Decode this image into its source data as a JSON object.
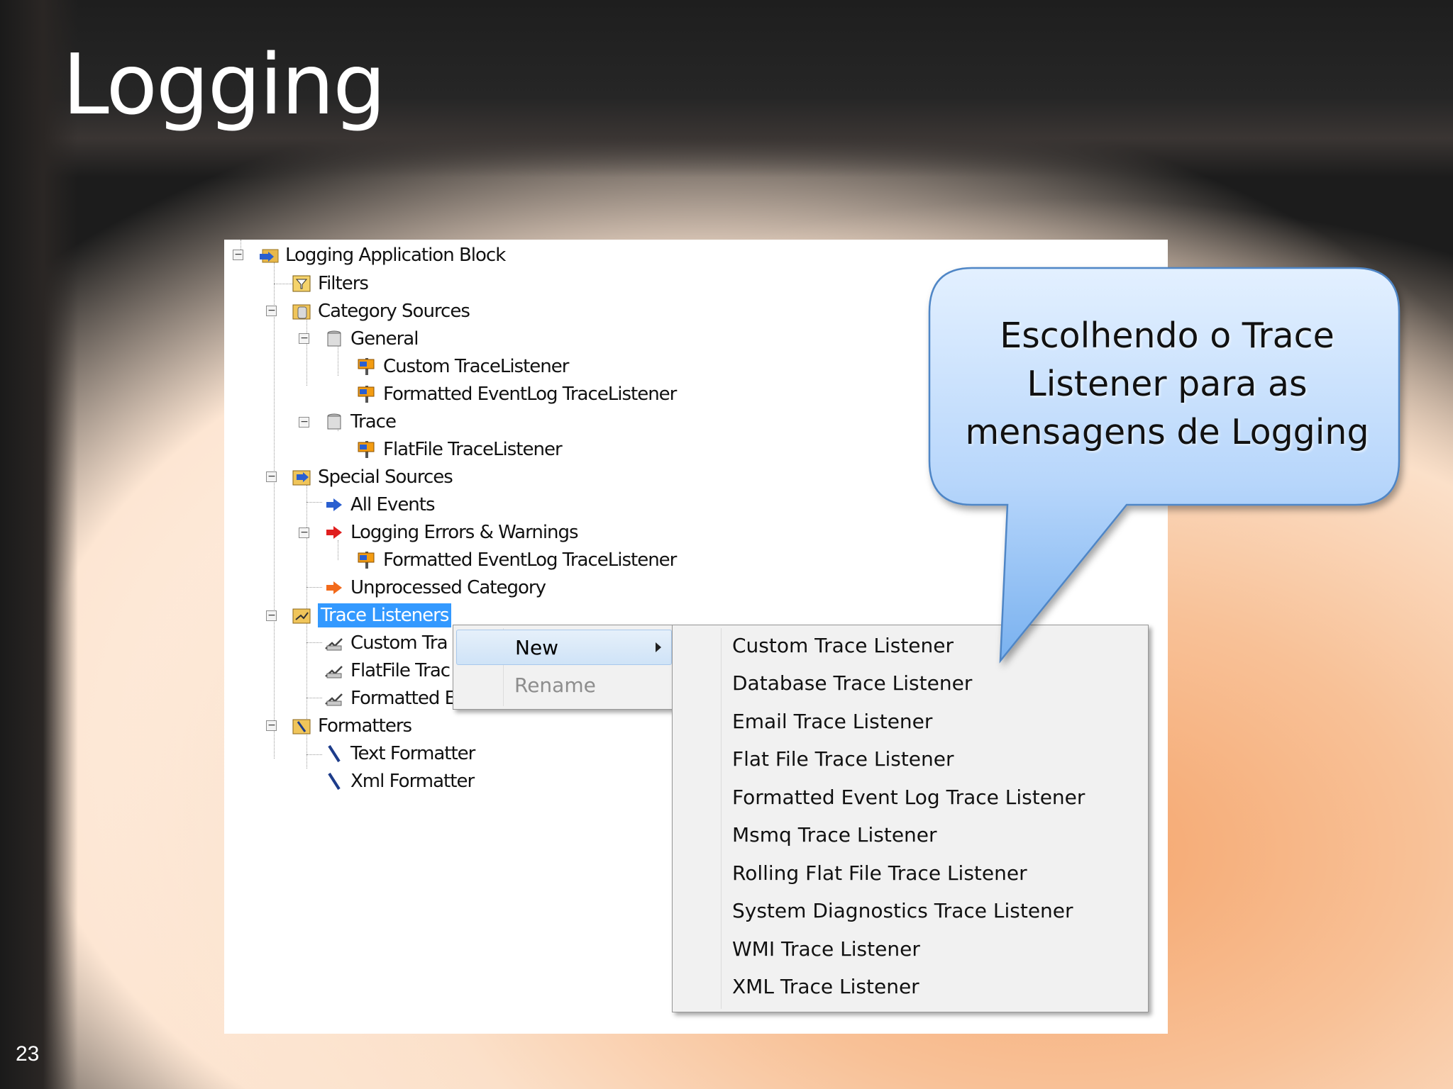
{
  "slide": {
    "title": "Logging",
    "number": "23"
  },
  "tree": {
    "nodes": [
      {
        "label": "Logging Application Block",
        "icon": "folder-block-icon"
      },
      {
        "label": "Filters",
        "icon": "filter-icon"
      },
      {
        "label": "Category Sources",
        "icon": "category-sources-icon"
      },
      {
        "label": "General",
        "icon": "category-icon"
      },
      {
        "label": "Custom TraceListener",
        "icon": "trace-listener-ref-icon"
      },
      {
        "label": "Formatted EventLog TraceListener",
        "icon": "trace-listener-ref-icon"
      },
      {
        "label": "Trace",
        "icon": "category-icon"
      },
      {
        "label": "FlatFile TraceListener",
        "icon": "trace-listener-ref-icon"
      },
      {
        "label": "Special Sources",
        "icon": "special-sources-icon"
      },
      {
        "label": "All Events",
        "icon": "blue-arrow-icon"
      },
      {
        "label": "Logging Errors & Warnings",
        "icon": "red-arrow-icon"
      },
      {
        "label": "Formatted EventLog TraceListener",
        "icon": "trace-listener-ref-icon"
      },
      {
        "label": "Unprocessed Category",
        "icon": "orange-arrow-icon"
      },
      {
        "label": "Trace Listeners",
        "icon": "trace-listeners-folder-icon"
      },
      {
        "label": "Custom Tra",
        "icon": "listener-icon"
      },
      {
        "label": "FlatFile Trac",
        "icon": "listener-icon"
      },
      {
        "label": "Formatted E",
        "icon": "listener-icon"
      },
      {
        "label": "Formatters",
        "icon": "formatters-icon"
      },
      {
        "label": "Text Formatter",
        "icon": "pen-icon"
      },
      {
        "label": "Xml Formatter",
        "icon": "pen-icon"
      }
    ],
    "expander_symbol": "−"
  },
  "context_menu": {
    "items": [
      {
        "label": "New"
      },
      {
        "label": "Rename"
      }
    ]
  },
  "submenu": {
    "items": [
      {
        "label": "Custom Trace Listener"
      },
      {
        "label": "Database Trace Listener"
      },
      {
        "label": "Email Trace Listener"
      },
      {
        "label": "Flat File Trace Listener"
      },
      {
        "label": "Formatted Event Log Trace Listener"
      },
      {
        "label": "Msmq Trace Listener"
      },
      {
        "label": "Rolling Flat File Trace Listener"
      },
      {
        "label": "System Diagnostics Trace Listener"
      },
      {
        "label": "WMI Trace Listener"
      },
      {
        "label": "XML Trace Listener"
      }
    ]
  },
  "callout": {
    "lines": [
      "Escolhendo o Trace",
      "Listener para as",
      "mensagens de Logging"
    ]
  },
  "colors": {
    "selection": "#3399ff",
    "callout_top": "#dfeeff",
    "callout_bottom": "#7fb6f2"
  }
}
